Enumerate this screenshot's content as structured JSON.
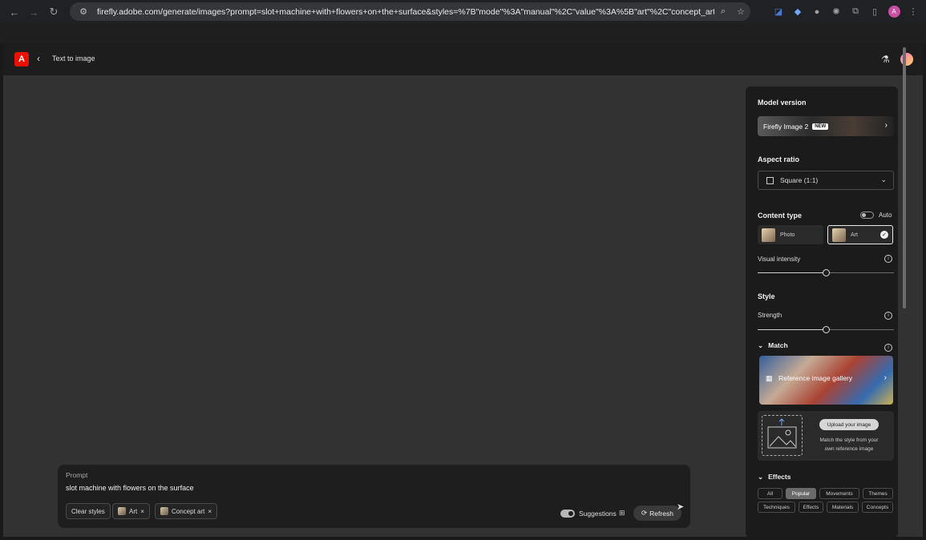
{
  "browser": {
    "url": "firefly.adobe.com/generate/images?prompt=slot+machine+with+flowers+on+the+surface&styles=%7B\"mode\"%3A\"manual\"%2C\"value\"%3A%5B\"art\"%2C\"concept_art\"...",
    "profile_initial": "A"
  },
  "header": {
    "title": "Text to image"
  },
  "prompt": {
    "label": "Prompt",
    "text": "slot machine with flowers on the surface",
    "clear_label": "Clear styles",
    "chips": [
      "Art",
      "Concept art"
    ],
    "suggestions_label": "Suggestions",
    "refresh_label": "Refresh"
  },
  "panel": {
    "model_version_title": "Model version",
    "model_name": "Firefly Image 2",
    "model_badge": "NEW",
    "aspect_title": "Aspect ratio",
    "aspect_value": "Square (1:1)",
    "content_type_title": "Content type",
    "auto_label": "Auto",
    "content_photo": "Photo",
    "content_art": "Art",
    "visual_intensity_label": "Visual intensity",
    "visual_intensity_value": 0.5,
    "style_title": "Style",
    "strength_label": "Strength",
    "strength_value": 0.5,
    "match_title": "Match",
    "ref_gallery_label": "Reference image gallery",
    "upload_btn": "Upload your image",
    "upload_desc": "Match the style from your own reference image",
    "effects_title": "Effects",
    "effect_tabs": [
      "All",
      "Popular",
      "Movements",
      "Themes",
      "Techniques",
      "Effects",
      "Materials",
      "Concepts"
    ],
    "effect_active": "Popular"
  }
}
